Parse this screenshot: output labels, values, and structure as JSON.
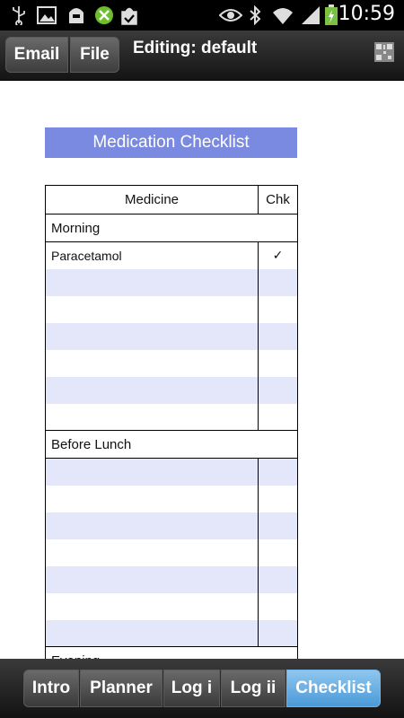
{
  "status_bar": {
    "time": "10:59",
    "icons": [
      "usb-icon",
      "image-icon",
      "bag-icon",
      "xbox-icon",
      "check-bag-icon",
      "eye-icon",
      "bluetooth-icon",
      "wifi-icon",
      "signal-icon",
      "battery-icon"
    ]
  },
  "action_bar": {
    "email_label": "Email",
    "file_label": "File",
    "title": "Editing: default",
    "qr_icon": "qr-code-icon"
  },
  "sheet": {
    "title": "Medication Checklist",
    "col_medicine": "Medicine",
    "col_check": "Chk",
    "sections": [
      {
        "label": "Morning",
        "rows": [
          {
            "medicine": "Paracetamol",
            "check": "✓"
          },
          {
            "medicine": "",
            "check": ""
          },
          {
            "medicine": "",
            "check": ""
          },
          {
            "medicine": "",
            "check": ""
          },
          {
            "medicine": "",
            "check": ""
          },
          {
            "medicine": "",
            "check": ""
          },
          {
            "medicine": "",
            "check": ""
          }
        ]
      },
      {
        "label": "Before Lunch",
        "rows": [
          {
            "medicine": "",
            "check": ""
          },
          {
            "medicine": "",
            "check": ""
          },
          {
            "medicine": "",
            "check": ""
          },
          {
            "medicine": "",
            "check": ""
          },
          {
            "medicine": "",
            "check": ""
          },
          {
            "medicine": "",
            "check": ""
          },
          {
            "medicine": "",
            "check": ""
          }
        ]
      },
      {
        "label": "Evening",
        "rows": []
      }
    ]
  },
  "tabs": [
    {
      "label": "Intro",
      "active": false
    },
    {
      "label": "Planner",
      "active": false
    },
    {
      "label": "Log i",
      "active": false
    },
    {
      "label": "Log ii",
      "active": false
    },
    {
      "label": "Checklist",
      "active": true
    }
  ],
  "colors": {
    "title_bar": "#7a8ae0",
    "alt_row": "#e4e6fa",
    "active_tab": "#5aa6e0"
  }
}
